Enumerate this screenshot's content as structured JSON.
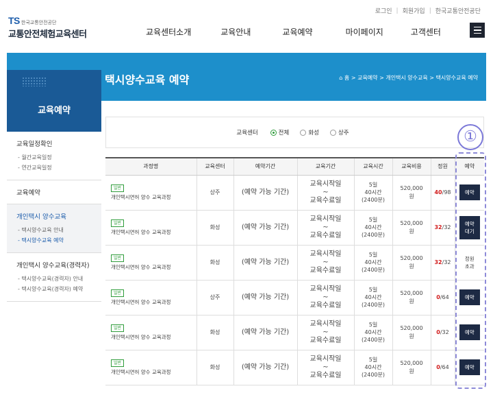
{
  "util": {
    "login": "로그인",
    "join": "회원가입",
    "org_link": "한국교통안전공단"
  },
  "logo": {
    "ts": "TS",
    "org": "한국교통안전공단",
    "name": "교통안전체험교육센터"
  },
  "gnb": [
    "교육센터소개",
    "교육안내",
    "교육예약",
    "마이페이지",
    "고객센터"
  ],
  "banner": {
    "title": "택시양수교육 예약",
    "breadcrumb": [
      "홈",
      "교육예약",
      "개인택시 양수교육",
      "택시양수교육 예약"
    ]
  },
  "sidebar": {
    "heading": "교육예약",
    "groups": [
      {
        "title": "교육일정확인",
        "subs": [
          "월간교육일정",
          "연간교육일정"
        ]
      },
      {
        "title": "교육예약",
        "subs": []
      },
      {
        "title": "개인택시 양수교육",
        "subs": [
          "택시양수교육 안내",
          "택시양수교육 예약"
        ]
      },
      {
        "title": "개인택시 양수교육(경력자)",
        "subs": [
          "택시양수교육(경력자) 안내",
          "택시양수교육(경력자) 예약"
        ]
      }
    ]
  },
  "filter": {
    "label": "교육센터",
    "options": [
      "전체",
      "화성",
      "상주"
    ],
    "selected": "전체"
  },
  "table": {
    "headers": [
      "과정명",
      "교육센터",
      "예약기간",
      "교육기간",
      "교육시간",
      "교육비용",
      "정원",
      "예약"
    ],
    "rows": [
      {
        "badge": "일반",
        "course": "개인택시면허 양수 교육과정",
        "center": "상주",
        "period": "(예약 가능 기간)",
        "edu_start": "교육시작일",
        "tilde": "~",
        "edu_end": "교육수료일",
        "days": "5일",
        "hours": "40시간",
        "mins": "(2400분)",
        "fee": "520,000",
        "won": "원",
        "cap_num": "40",
        "cap_total": "/98",
        "action": "예약",
        "action2": ""
      },
      {
        "badge": "일반",
        "course": "개인택시면허 양수 교육과정",
        "center": "화성",
        "period": "(예약 가능 기간)",
        "edu_start": "교육시작일",
        "tilde": "~",
        "edu_end": "교육수료일",
        "days": "5일",
        "hours": "40시간",
        "mins": "(2400분)",
        "fee": "520,000",
        "won": "원",
        "cap_num": "32",
        "cap_total": "/32",
        "action": "예약",
        "action2": "대기"
      },
      {
        "badge": "일반",
        "course": "개인택시면허 양수 교육과정",
        "center": "화성",
        "period": "(예약 가능 기간)",
        "edu_start": "교육시작일",
        "tilde": "~",
        "edu_end": "교육수료일",
        "days": "5일",
        "hours": "40시간",
        "mins": "(2400분)",
        "fee": "520,000",
        "won": "원",
        "cap_num": "32",
        "cap_total": "/32",
        "action": "정원",
        "action2": "초과"
      },
      {
        "badge": "일반",
        "course": "개인택시면허 양수 교육과정",
        "center": "상주",
        "period": "(예약 가능 기간)",
        "edu_start": "교육시작일",
        "tilde": "~",
        "edu_end": "교육수료일",
        "days": "5일",
        "hours": "40시간",
        "mins": "(2400분)",
        "fee": "520,000",
        "won": "원",
        "cap_num": "0",
        "cap_total": "/64",
        "action": "예약",
        "action2": ""
      },
      {
        "badge": "일반",
        "course": "개인택시면허 양수 교육과정",
        "center": "화성",
        "period": "(예약 가능 기간)",
        "edu_start": "교육시작일",
        "tilde": "~",
        "edu_end": "교육수료일",
        "days": "5일",
        "hours": "40시간",
        "mins": "(2400분)",
        "fee": "520,000",
        "won": "원",
        "cap_num": "0",
        "cap_total": "/32",
        "action": "예약",
        "action2": ""
      },
      {
        "badge": "일반",
        "course": "개인택시면허 양수 교육과정",
        "center": "화성",
        "period": "(예약 가능 기간)",
        "edu_start": "교육시작일",
        "tilde": "~",
        "edu_end": "교육수료일",
        "days": "5일",
        "hours": "40시간",
        "mins": "(2400분)",
        "fee": "520,000",
        "won": "원",
        "cap_num": "0",
        "cap_total": "/64",
        "action": "예약",
        "action2": ""
      }
    ]
  },
  "annotation": {
    "marker": "①",
    "color": "#7b78d8"
  },
  "colors": {
    "banner": "#1d8fcb",
    "sidebar_head": "#1a5a96",
    "button": "#1d2a44",
    "badge": "#2e9c3a",
    "capacity_red": "#d11d1d"
  }
}
